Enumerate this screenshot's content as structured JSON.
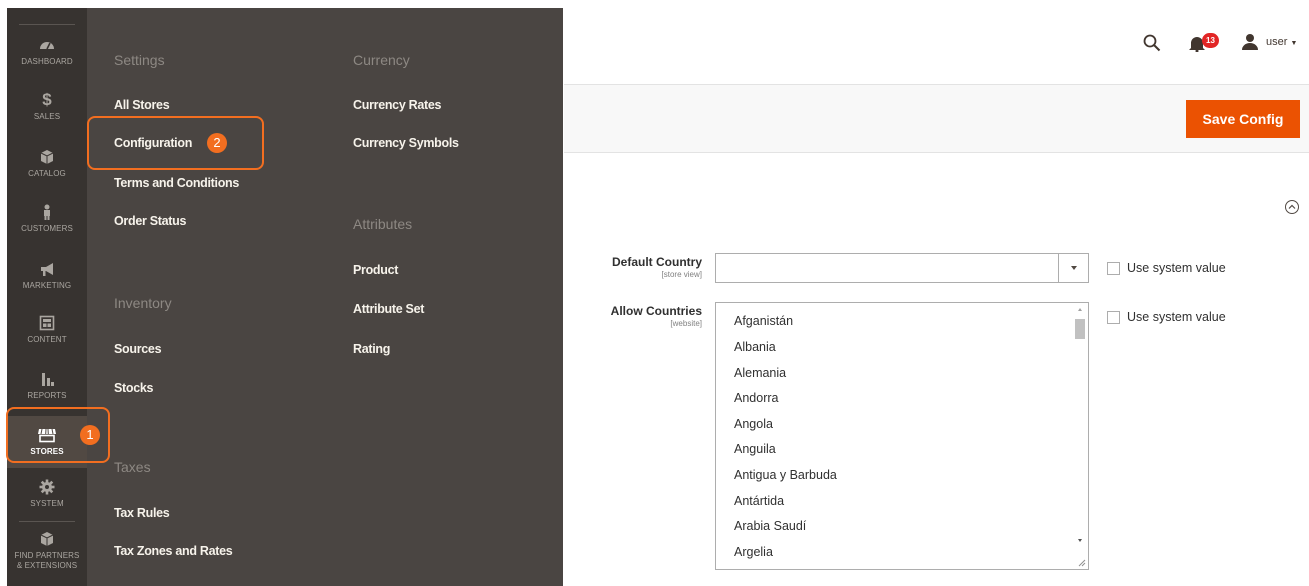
{
  "nav": {
    "items": [
      {
        "label": "DASHBOARD",
        "icon": "dashboard-icon"
      },
      {
        "label": "SALES",
        "icon": "dollar-icon"
      },
      {
        "label": "CATALOG",
        "icon": "box-icon"
      },
      {
        "label": "CUSTOMERS",
        "icon": "person-icon"
      },
      {
        "label": "MARKETING",
        "icon": "megaphone-icon"
      },
      {
        "label": "CONTENT",
        "icon": "layout-icon"
      },
      {
        "label": "REPORTS",
        "icon": "bar-chart-icon"
      },
      {
        "label": "STORES",
        "icon": "store-icon"
      },
      {
        "label": "SYSTEM",
        "icon": "gear-icon"
      },
      {
        "label": "FIND PARTNERS & EXTENSIONS",
        "icon": "box-icon"
      }
    ],
    "active": "STORES"
  },
  "flyout": {
    "settings": {
      "heading": "Settings",
      "links": [
        "All Stores",
        "Configuration",
        "Terms and Conditions",
        "Order Status"
      ]
    },
    "inventory": {
      "heading": "Inventory",
      "links": [
        "Sources",
        "Stocks"
      ]
    },
    "taxes": {
      "heading": "Taxes",
      "links": [
        "Tax Rules",
        "Tax Zones and Rates"
      ]
    },
    "currency": {
      "heading": "Currency",
      "links": [
        "Currency Rates",
        "Currency Symbols"
      ]
    },
    "attributes": {
      "heading": "Attributes",
      "links": [
        "Product",
        "Attribute Set",
        "Rating"
      ]
    }
  },
  "callouts": {
    "one": "1",
    "two": "2"
  },
  "header": {
    "notification_count": "13",
    "user_name": "user",
    "save_label": "Save Config"
  },
  "form": {
    "default_country": {
      "label": "Default Country",
      "scope": "[store view]",
      "value": "",
      "use_system": "Use system value"
    },
    "allow_countries": {
      "label": "Allow Countries",
      "scope": "[website]",
      "use_system": "Use system value",
      "options": [
        "Afganistán",
        "Albania",
        "Alemania",
        "Andorra",
        "Angola",
        "Anguila",
        "Antigua y Barbuda",
        "Antártida",
        "Arabia Saudí",
        "Argelia"
      ]
    }
  },
  "colors": {
    "accent": "#eb5202",
    "callout": "#f26e20",
    "nav_bg": "#373330",
    "flyout_bg": "#4a4542"
  }
}
